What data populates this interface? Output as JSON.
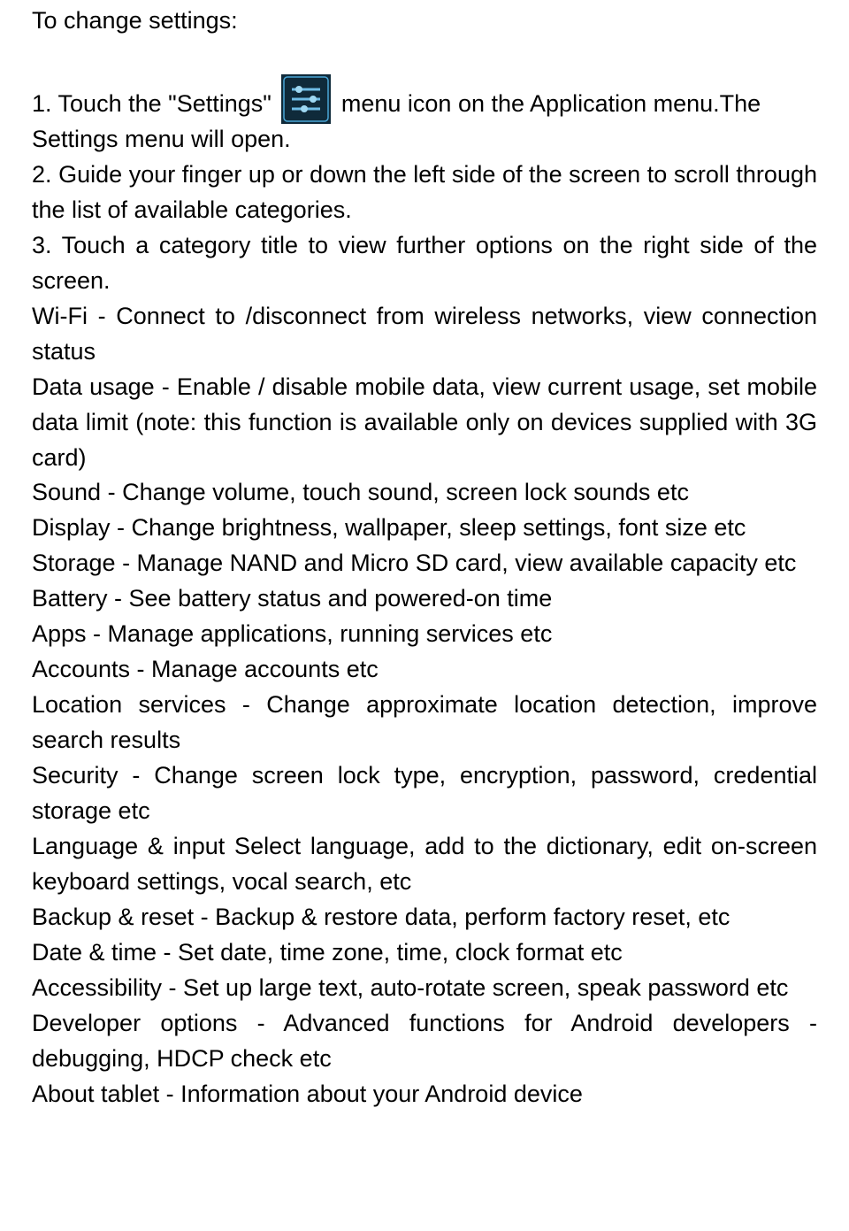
{
  "heading": "To change settings:",
  "step1_prefix": "1. Touch the \"Settings\"",
  "step1_suffix": "menu icon on the Application menu.The",
  "step1_line2": "Settings menu will open.",
  "step2": "2. Guide your finger up or down the left side of the screen to scroll through the list of available categories.",
  "step3": "3. Touch a category title to view further options on the right side of the screen.",
  "cat_wifi": "Wi-Fi - Connect to /disconnect from wireless networks, view connection status",
  "cat_data": "Data usage - Enable / disable mobile data, view current usage, set mobile data limit (note: this function is available only on devices supplied with 3G card)",
  "cat_sound": "Sound - Change volume, touch sound, screen lock sounds etc",
  "cat_display": "Display - Change brightness, wallpaper, sleep settings, font size etc",
  "cat_storage": "Storage - Manage NAND and Micro SD card, view available capacity etc",
  "cat_battery": "Battery - See battery status and powered-on time",
  "cat_apps": "Apps - Manage applications, running services etc",
  "cat_accounts": "Accounts - Manage accounts etc",
  "cat_location": "Location services - Change approximate location detection, improve search results",
  "cat_security": "Security - Change screen lock type, encryption, password, credential storage etc",
  "cat_lang": "Language & input Select language, add to the dictionary, edit on-screen keyboard settings, vocal search, etc",
  "cat_backup": "Backup & reset - Backup & restore data, perform factory reset, etc",
  "cat_date": "Date & time - Set date, time zone, time, clock format etc",
  "cat_access": "Accessibility - Set up large text, auto-rotate screen, speak password etc",
  "cat_dev": "Developer options - Advanced functions for Android developers - debugging, HDCP check etc",
  "cat_about": "About tablet - Information about your Android device"
}
